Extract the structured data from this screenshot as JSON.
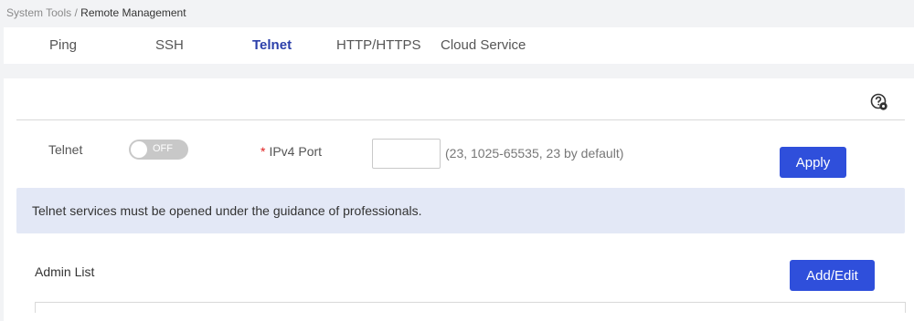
{
  "breadcrumb": {
    "parent": "System Tools",
    "separator": "/",
    "current": "Remote Management"
  },
  "tabs": [
    {
      "label": "Ping",
      "active": false
    },
    {
      "label": "SSH",
      "active": false
    },
    {
      "label": "Telnet",
      "active": true
    },
    {
      "label": "HTTP/HTTPS",
      "active": false
    },
    {
      "label": "Cloud Service",
      "active": false
    }
  ],
  "telnet": {
    "label": "Telnet",
    "toggle_state": "OFF",
    "port_required_mark": "*",
    "port_label": "IPv4 Port",
    "port_value": "",
    "port_hint": "(23, 1025-65535, 23 by default)",
    "apply_label": "Apply"
  },
  "notice": "Telnet services must be opened under the guidance of professionals.",
  "admin": {
    "title": "Admin List",
    "add_edit_label": "Add/Edit"
  },
  "icons": {
    "help": "help-settings-icon"
  },
  "colors": {
    "accent": "#2f4fdb",
    "active_tab": "#2b3faa",
    "notice_bg": "#e3e8f6",
    "toggle_off": "#c8c8c8",
    "required": "#e02020"
  }
}
